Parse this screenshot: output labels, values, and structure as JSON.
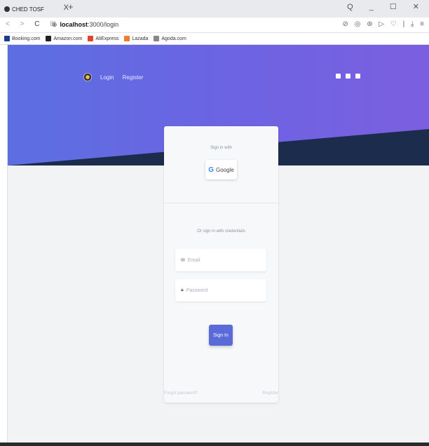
{
  "browser": {
    "tab_title": "CHED TOSF",
    "tab_close": "X",
    "new_tab": "+",
    "window_controls": "Q _ ☐ ✕",
    "nav_back": "<",
    "nav_forward": ">",
    "nav_reload": "C",
    "nav_grid": "⊞",
    "url_host": "localhost",
    "url_path": ":3000/login",
    "toolbar_icons": "⊘ ◎ ⊛ ▷ ♡ | ⤓ ≡"
  },
  "bookmarks": [
    {
      "label": "Booking.com",
      "color": "#1a3d8f"
    },
    {
      "label": "Amazon.com",
      "color": "#222222"
    },
    {
      "label": "AliExpress",
      "color": "#e0452b"
    },
    {
      "label": "Lazada",
      "color": "#f07b2b"
    },
    {
      "label": "Agoda.com",
      "color": "#888888"
    }
  ],
  "hero": {
    "nav_login": "Login",
    "nav_register": "Register",
    "social_facebook": "facebook-icon",
    "social_twitter": "twitter-icon",
    "social_github": "github-icon"
  },
  "card": {
    "sign_in_with": "Sign in with",
    "google_label": "Google",
    "or_credentials": "Or sign in with credentials",
    "email_placeholder": "Email",
    "password_placeholder": "Password",
    "sign_in_button": "Sign In"
  },
  "footer_links": {
    "forgot": "Forgot password?",
    "register": "Register"
  },
  "colors": {
    "hero_start": "#5c6fe2",
    "hero_end": "#7b5fe0",
    "dark_band": "#1c2c4c",
    "primary_button": "#5a6ad9"
  }
}
